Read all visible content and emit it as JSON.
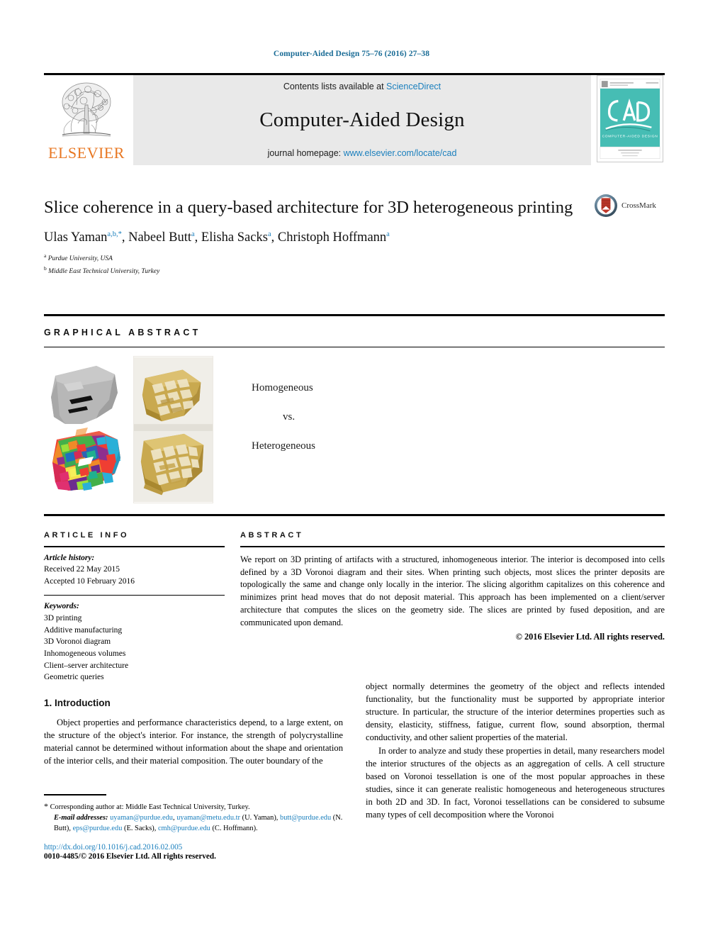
{
  "running_head": "Computer-Aided Design 75–76 (2016) 27–38",
  "masthead": {
    "publisher_name": "ELSEVIER",
    "contents_line_prefix": "Contents lists available at ",
    "contents_line_link": "ScienceDirect",
    "journal_title": "Computer-Aided Design",
    "homepage_prefix": "journal homepage: ",
    "homepage_link": "www.elsevier.com/locate/cad",
    "cover_title": "CAD",
    "cover_subtitle": "COMPUTER-AIDED DESIGN"
  },
  "title_block": {
    "title": "Slice coherence in a query-based architecture for 3D heterogeneous printing",
    "crossmark_label": "CrossMark",
    "authors": [
      {
        "name": "Ulas Yaman",
        "marks": "a,b,*"
      },
      {
        "name": "Nabeel Butt",
        "marks": "a"
      },
      {
        "name": "Elisha Sacks",
        "marks": "a"
      },
      {
        "name": "Christoph Hoffmann",
        "marks": "a"
      }
    ],
    "affiliations": [
      {
        "mark": "a",
        "text": "Purdue University, USA"
      },
      {
        "mark": "b",
        "text": "Middle East Technical University, Turkey"
      }
    ]
  },
  "graphical_abstract": {
    "heading": "GRAPHICAL ABSTRACT",
    "label_top": "Homogeneous",
    "label_mid": "vs.",
    "label_bottom": "Heterogeneous"
  },
  "article_info": {
    "heading": "ARTICLE INFO",
    "history_label": "Article history:",
    "history": [
      "Received 22 May 2015",
      "Accepted 10 February 2016"
    ],
    "keywords_label": "Keywords:",
    "keywords": [
      "3D printing",
      "Additive manufacturing",
      "3D Voronoi diagram",
      "Inhomogeneous volumes",
      "Client–server architecture",
      "Geometric queries"
    ]
  },
  "abstract": {
    "heading": "ABSTRACT",
    "text": "We report on 3D printing of artifacts with a structured, inhomogeneous interior. The interior is decomposed into cells defined by a 3D Voronoi diagram and their sites. When printing such objects, most slices the printer deposits are topologically the same and change only locally in the interior. The slicing algorithm capitalizes on this coherence and minimizes print head moves that do not deposit material. This approach has been implemented on a client/server architecture that computes the slices on the geometry side. The slices are printed by fused deposition, and are communicated upon demand.",
    "copyright": "© 2016 Elsevier Ltd. All rights reserved."
  },
  "body": {
    "section_1_heading": "1. Introduction",
    "left_paragraphs": [
      "Object properties and performance characteristics depend, to a large extent, on the structure of the object's interior. For instance, the strength of polycrystalline material cannot be determined without information about the shape and orientation of the interior cells, and their material composition. The outer boundary of the"
    ],
    "right_paragraphs": [
      "object normally determines the geometry of the object and reflects intended functionality, but the functionality must be supported by appropriate interior structure. In particular, the structure of the interior determines properties such as density, elasticity, stiffness, fatigue, current flow, sound absorption, thermal conductivity, and other salient properties of the material.",
      "In order to analyze and study these properties in detail, many researchers model the interior structures of the objects as an aggregation of cells. A cell structure based on Voronoi tessellation is one of the most popular approaches in these studies, since it can generate realistic homogeneous and heterogeneous structures in both 2D and 3D. In fact, Voronoi tessellations can be considered to subsume many types of cell decomposition where the Voronoi"
    ]
  },
  "footnotes": {
    "corresponding_star": "*",
    "corresponding_text": "Corresponding author at: Middle East Technical University, Turkey.",
    "email_label": "E-mail addresses:",
    "emails": [
      {
        "addr": "uyaman@purdue.edu",
        "sep": ", "
      },
      {
        "addr": "uyaman@metu.edu.tr",
        "sep": " (U. Yaman), "
      },
      {
        "addr": "butt@purdue.edu",
        "sep": " (N. Butt), "
      },
      {
        "addr": "eps@purdue.edu",
        "sep": " (E. Sacks), "
      },
      {
        "addr": "cmh@purdue.edu",
        "sep": ""
      }
    ],
    "emails_tail": "(C. Hoffmann).",
    "doi": "http://dx.doi.org/10.1016/j.cad.2016.02.005",
    "issn_line": "0010-4485/© 2016 Elsevier Ltd. All rights reserved."
  },
  "colors": {
    "link": "#1a7fbd",
    "elsevier_orange": "#E87722",
    "cover_teal": "#3fb9b0",
    "banner_gray": "#e9e9e9"
  }
}
